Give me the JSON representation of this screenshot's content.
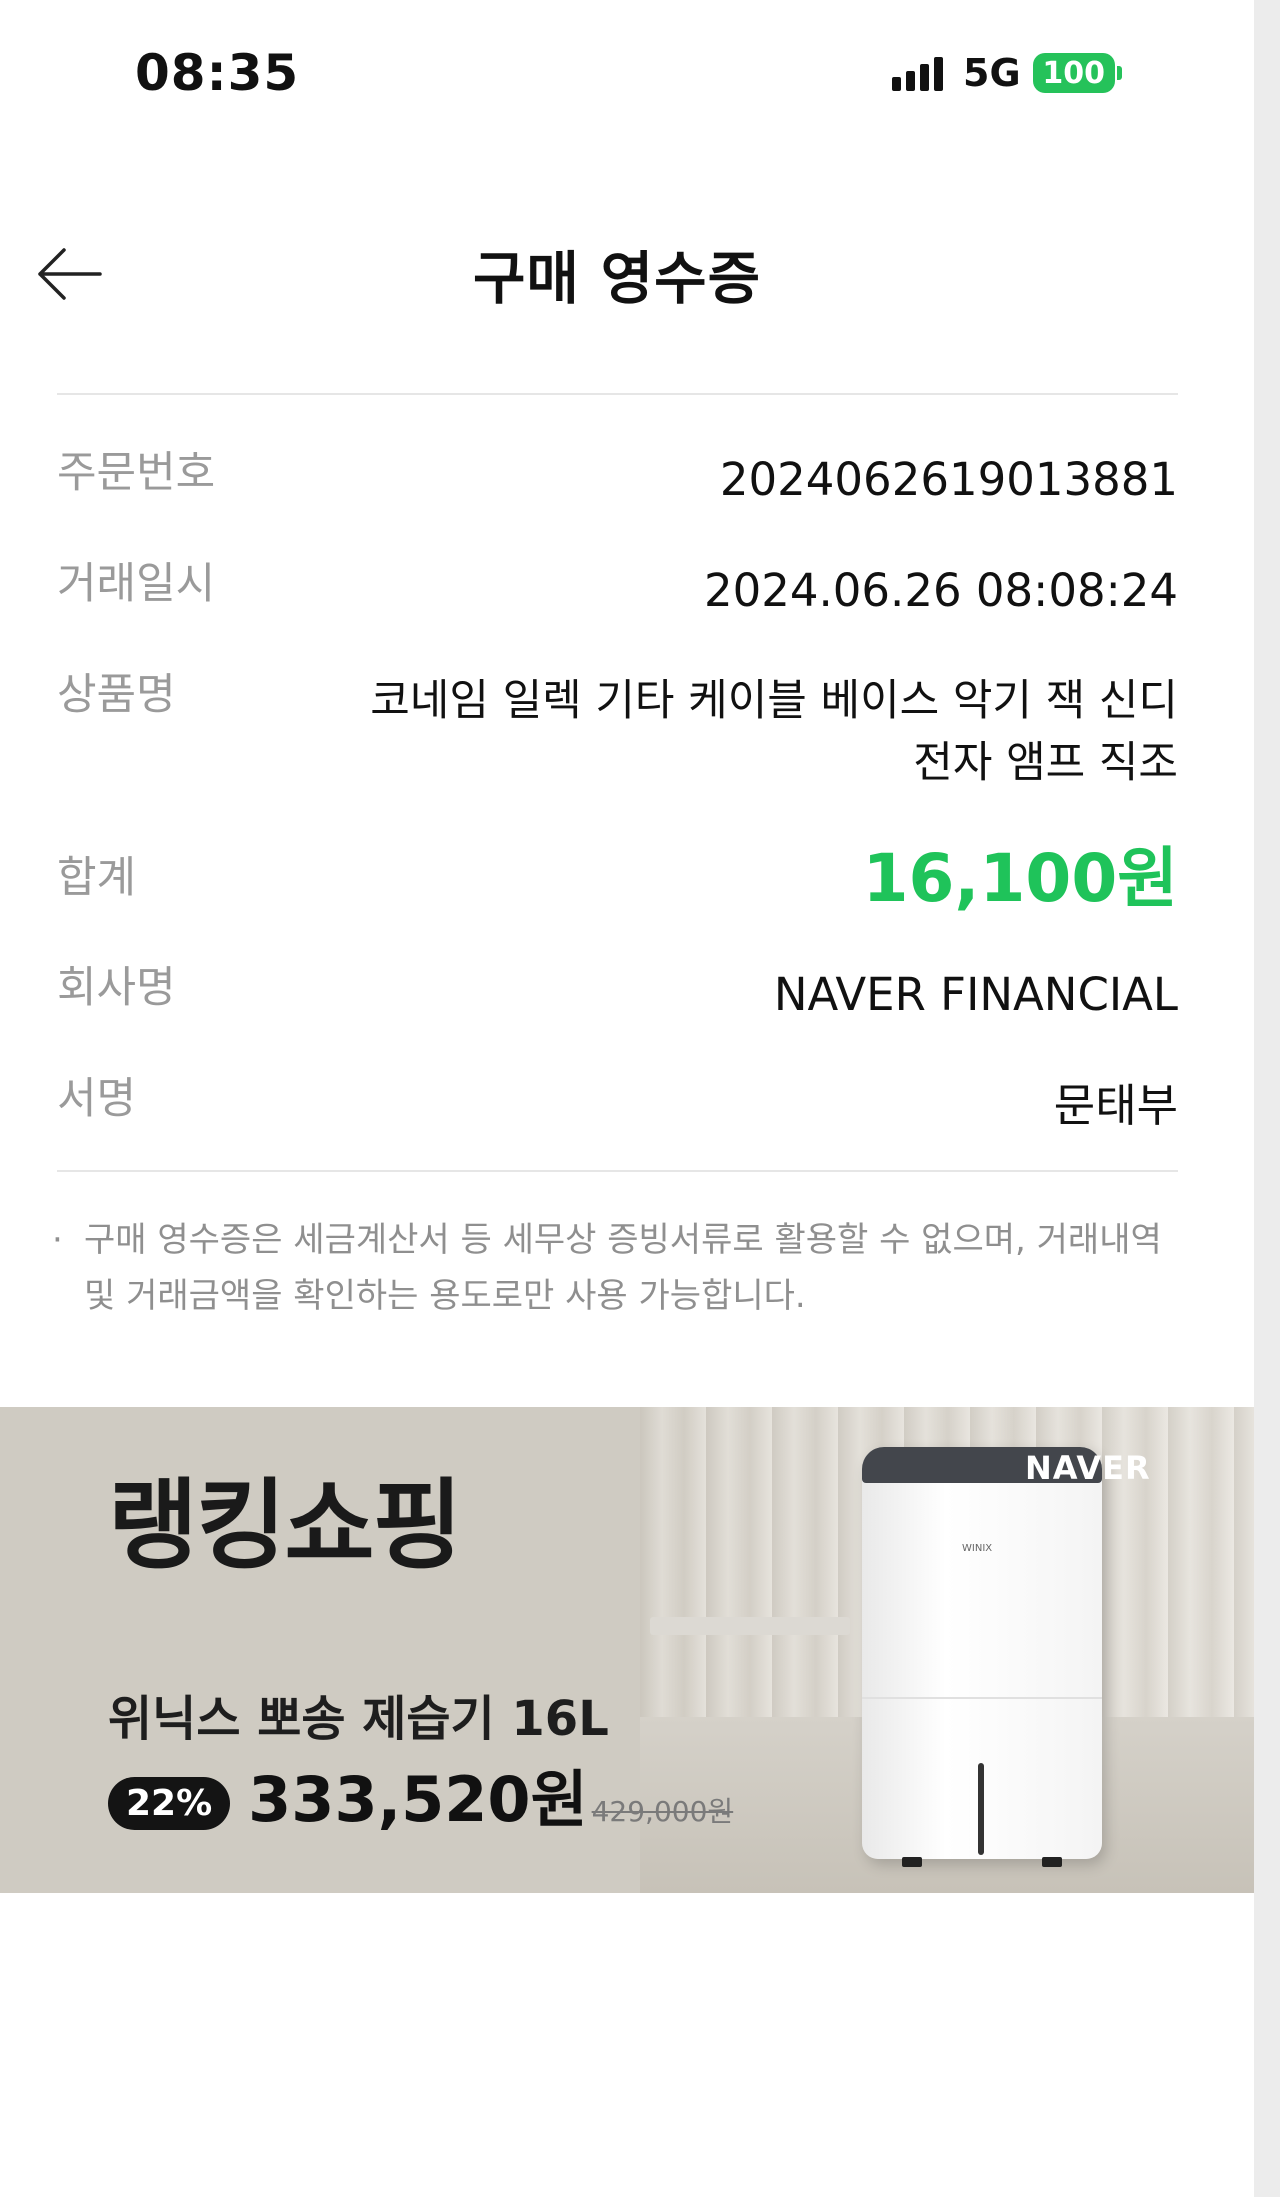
{
  "status_bar": {
    "time": "08:35",
    "network": "5G",
    "battery": "100",
    "battery_color": "#25c25a"
  },
  "header": {
    "back_icon": "arrow-left-icon",
    "title": "구매 영수증"
  },
  "receipt": {
    "order_number_label": "주문번호",
    "order_number": "2024062619013881",
    "datetime_label": "거래일시",
    "datetime": "2024.06.26 08:08:24",
    "product_label": "상품명",
    "product_name": "코네임 일렉 기타 케이블 베이스 악기 잭 신디 전자 앰프 직조",
    "total_label": "합계",
    "total": "16,100원",
    "total_color": "#1fc35a",
    "company_label": "회사명",
    "company": "NAVER FINANCIAL",
    "signature_label": "서명",
    "signature": "문태부"
  },
  "notice": {
    "bullet": "·",
    "text": "구매 영수증은 세금계산서 등 세무상 증빙서류로 활용할 수 없으며, 거래내역 및 거래금액을 확인하는 용도로만 사용 가능합니다."
  },
  "banner": {
    "logo_text": "랭킹쇼핑",
    "brand": "NAVER",
    "product_name": "위닉스 뽀송 제습기 16L",
    "discount": "22%",
    "price": "333,520원",
    "original_price": "429,000원",
    "appliance_label": "WINIX"
  }
}
